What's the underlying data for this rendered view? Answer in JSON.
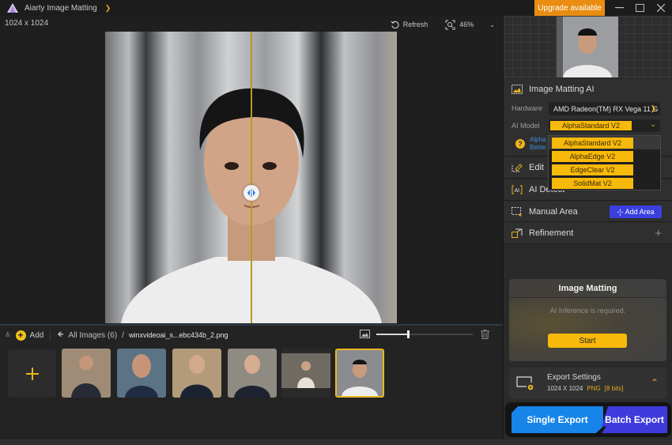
{
  "titlebar": {
    "app_title": "Aiarty Image Matting",
    "upgrade_label": "Upgrade available",
    "colors": {
      "upgrade": "#e98d12",
      "accent": "#f7b90a"
    }
  },
  "canvas": {
    "dimensions": "1024 x 1024",
    "refresh_label": "Refresh",
    "zoom_level": "46%"
  },
  "strip": {
    "add_label": "Add",
    "breadcrumb_all": "All Images (6)",
    "breadcrumb_sep": "/",
    "current_file": "winxvideoai_s...ebc434b_2.png",
    "thumb_size_fraction": 0.33
  },
  "gallery": {
    "items": [
      {
        "label": "man-glasses-arms-crossed",
        "selected": false
      },
      {
        "label": "bearded-man-portrait",
        "selected": false
      },
      {
        "label": "woman-glasses-arms-crossed",
        "selected": false
      },
      {
        "label": "woman-suit-portrait",
        "selected": false
      },
      {
        "label": "woman-cafe-sweater",
        "selected": false
      },
      {
        "label": "man-white-tshirt-curtain",
        "selected": true
      }
    ]
  },
  "right_panel": {
    "matting_ai": {
      "title": "Image Matting AI",
      "hardware_label": "Hardware",
      "hardware_value": "AMD Radeon(TM) RX Vega 11 G",
      "model_label": "AI Model",
      "model_value": "AlphaStandard  V2",
      "help_line1": "Alpha",
      "help_line2": "Better",
      "model_options": [
        "AlphaStandard  V2",
        "AlphaEdge  V2",
        "EdgeClear  V2",
        "SolidMat  V2"
      ]
    },
    "sections": {
      "edit": "Edit",
      "ai_detect": "AI Detect",
      "manual_area": "Manual Area",
      "add_area": "Add Area",
      "refinement": "Refinement"
    },
    "matting_card": {
      "title": "Image Matting",
      "message": "AI Inference is required.",
      "start_label": "Start"
    },
    "export": {
      "title": "Export Settings",
      "resolution": "1024 X 1024",
      "format": "PNG",
      "bits": "[8 bits]",
      "single_label": "Single Export",
      "batch_label": "Batch Export"
    }
  }
}
